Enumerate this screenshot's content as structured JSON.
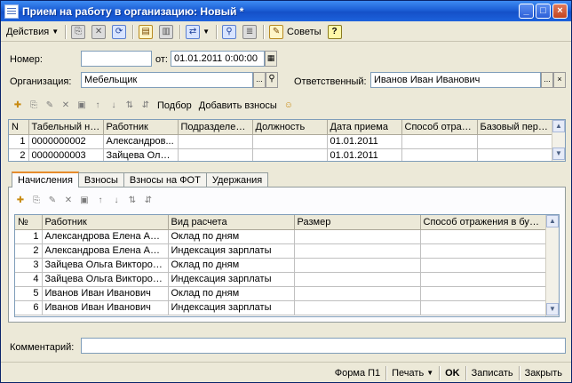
{
  "window": {
    "title": "Прием на работу в организацию: Новый *",
    "buttons": {
      "minimize": "_",
      "maximize": "□",
      "close": "×"
    }
  },
  "toolbar": {
    "actions_label": "Действия",
    "advice_label": "Советы",
    "help_label": "?"
  },
  "form": {
    "number_label": "Номер:",
    "number_value": "",
    "from_label": "от:",
    "date_value": "01.01.2011  0:00:00",
    "org_label": "Организация:",
    "org_value": "Мебельщик",
    "responsible_label": "Ответственный:",
    "responsible_value": "Иванов Иван Иванович",
    "comment_label": "Комментарий:",
    "comment_value": "",
    "ellipsis": "...",
    "clear": "×"
  },
  "employees_toolbar": {
    "select_label": "Подбор",
    "add_contrib_label": "Добавить взносы"
  },
  "employees_table": {
    "columns": [
      "N",
      "Табельный но...",
      "Работник",
      "Подразделен...",
      "Должность",
      "Дата приема",
      "Способ отраж...",
      "Базовый пери..."
    ],
    "rows": [
      [
        "1",
        "0000000002",
        "Александров...",
        "",
        "",
        "01.01.2011",
        "",
        ""
      ],
      [
        "2",
        "0000000003",
        "Зайцева Ольг...",
        "",
        "",
        "01.01.2011",
        "",
        ""
      ]
    ]
  },
  "tabs": [
    {
      "label": "Начисления",
      "active": true
    },
    {
      "label": "Взносы",
      "active": false
    },
    {
      "label": "Взносы на ФОТ",
      "active": false
    },
    {
      "label": "Удержания",
      "active": false
    }
  ],
  "accruals_table": {
    "columns": [
      "№",
      "Работник",
      "Вид расчета",
      "Размер",
      "Способ отражения в бухуч..."
    ],
    "rows": [
      [
        "1",
        "Александрова Елена Анд...",
        "Оклад по дням",
        "",
        ""
      ],
      [
        "2",
        "Александрова Елена Анд...",
        "Индексация зарплаты",
        "",
        ""
      ],
      [
        "3",
        "Зайцева Ольга Викторов...",
        "Оклад по дням",
        "",
        ""
      ],
      [
        "4",
        "Зайцева Ольга Викторов...",
        "Индексация зарплаты",
        "",
        ""
      ],
      [
        "5",
        "Иванов Иван Иванович",
        "Оклад по дням",
        "",
        ""
      ],
      [
        "6",
        "Иванов Иван Иванович",
        "Индексация зарплаты",
        "",
        ""
      ]
    ]
  },
  "bottombar": {
    "form_p1": "Форма П1",
    "print": "Печать",
    "ok": "OK",
    "save": "Записать",
    "close": "Закрыть"
  }
}
